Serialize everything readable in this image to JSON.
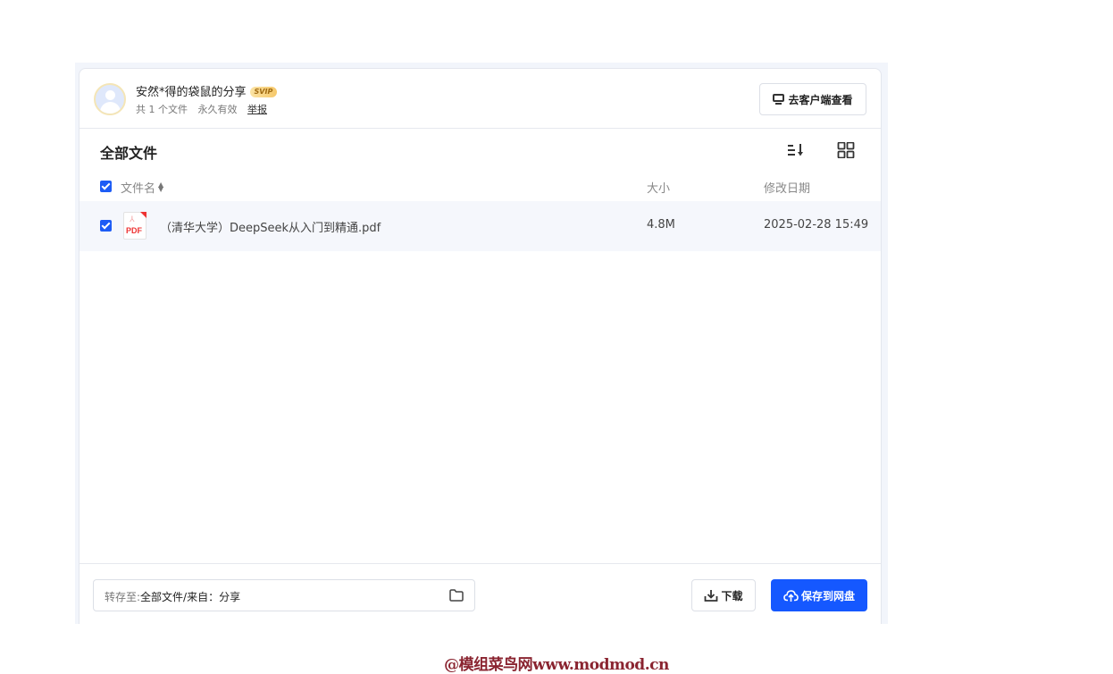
{
  "share": {
    "title": "安然*得的袋鼠的分享",
    "badge": "SVIP",
    "file_count": "共 1 个文件",
    "validity": "永久有效",
    "report": "举报",
    "client_button": "去客户端查看"
  },
  "listing": {
    "title": "全部文件",
    "columns": {
      "name": "文件名",
      "size": "大小",
      "modified": "修改日期"
    },
    "files": [
      {
        "type_label": "PDF",
        "name": "（清华大学）DeepSeek从入门到精通.pdf",
        "size": "4.8M",
        "modified": "2025-02-28 15:49",
        "checked": true
      }
    ]
  },
  "footer": {
    "save_to_label": "转存至:",
    "save_to_path": "全部文件/来自：分享",
    "download": "下载",
    "save": "保存到网盘"
  },
  "watermark": "@模组菜鸟网www.modmod.cn",
  "colors": {
    "accent": "#1558ff",
    "checkbox": "#1d5cf5",
    "row_highlight": "#f5f7fc"
  }
}
